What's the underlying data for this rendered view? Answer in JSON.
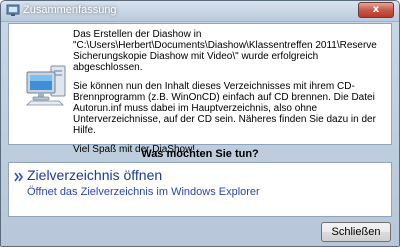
{
  "window": {
    "title": "Zusammenfassung",
    "close_glyph": "x"
  },
  "info": {
    "paragraphs": [
      "Das Erstellen der Diashow in \"C:\\Users\\Herbert\\Documents\\Diashow\\Klassentreffen 2011\\Reserve Sicherungskopie Diashow mit Video\\\" wurde erfolgreich abgeschlossen.",
      "Sie können nun den Inhalt dieses Verzeichnisses mit ihrem CD-Brennprogramm (z.B. WinOnCD) einfach auf CD brennen. Die Datei Autorun.inf muss dabei im Hauptverzeichnis, also ohne Unterverzeichnisse, auf der CD sein. Näheres finden Sie dazu in der Hilfe.",
      "Viel Spaß mit der DiaShow!"
    ]
  },
  "question": "Was möchten Sie tun?",
  "action": {
    "title": "Zielverzeichnis öffnen",
    "description": "Öffnet das Zielverzeichnis im Windows Explorer"
  },
  "buttons": {
    "close_label": "Schließen"
  },
  "colors": {
    "link_title": "#1f3a9c",
    "link_desc": "#2b48b0",
    "close_button": "#c75a4b"
  },
  "icons": {
    "app": "app-icon",
    "computer": "computer-icon",
    "action": "double-arrow-icon"
  }
}
